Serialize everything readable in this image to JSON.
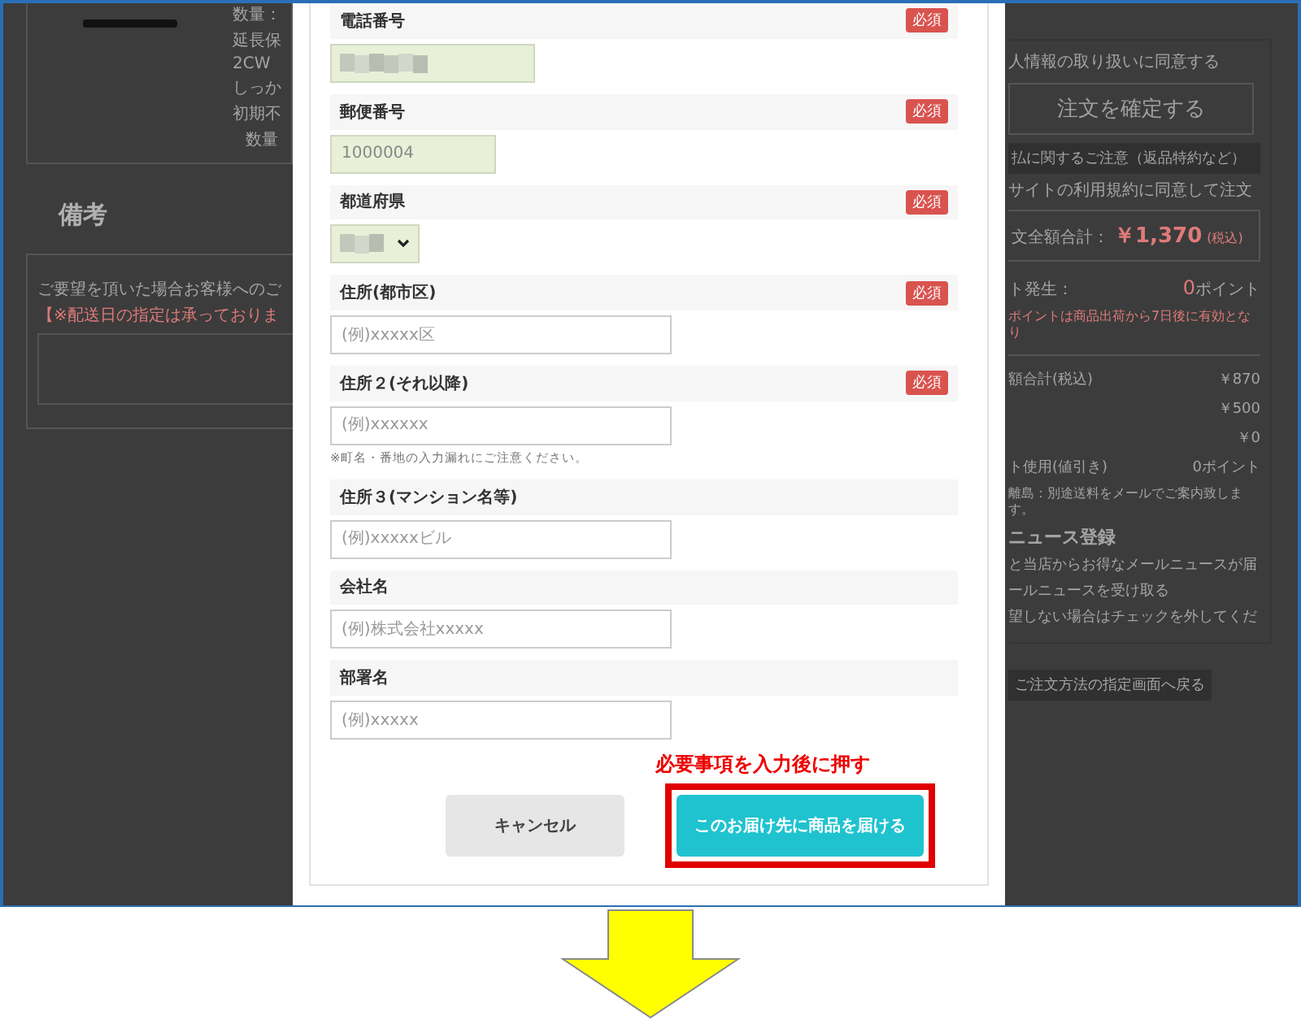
{
  "background": {
    "left": {
      "product": {
        "lines": [
          "数量：",
          "延長保",
          "2CW",
          "しっか",
          "初期不"
        ],
        "quantity": "数量"
      },
      "remarks": {
        "heading": "備考",
        "note": "ご要望を頂いた場合お客様へのご",
        "warning": "【※配送日の指定は承っておりま"
      }
    },
    "right": {
      "agree": "人情報の取り扱いに同意する",
      "confirm_button": "注文を確定する",
      "notice_bar": "払に関するご注意（返品特約など）",
      "terms": "サイトの利用規約に同意して注文",
      "total": {
        "label": "文全額合計：",
        "amount": "￥1,370",
        "tax": "(税込)"
      },
      "points": {
        "label": "ト発生：",
        "value": "0",
        "unit": "ポイント"
      },
      "points_note": "ポイントは商品出荷から7日後に有効となり",
      "summary": [
        {
          "label": "額合計(税込)",
          "value": "￥870"
        },
        {
          "value": "￥500"
        },
        {
          "value": "￥0"
        },
        {
          "label": "ト使用(値引き)",
          "value": "0ポイント"
        }
      ],
      "shipping_note": "離島：別途送料をメールでご案内致します。",
      "newsletter": {
        "heading": "ニュース登録",
        "text": "と当店からお得なメールニュースが届",
        "option": "ールニュースを受け取る",
        "hint": "望しない場合はチェックを外してくだ"
      },
      "back_button": "ご注文方法の指定画面へ戻る"
    }
  },
  "modal": {
    "fields": [
      {
        "label": "電話番号",
        "required": true,
        "badge": "必須",
        "input": {
          "kind": "text",
          "redacted": true,
          "autofilled": true
        }
      },
      {
        "label": "郵便番号",
        "required": true,
        "badge": "必須",
        "input": {
          "kind": "text",
          "value": "1000004",
          "autofilled": true
        }
      },
      {
        "label": "都道府県",
        "required": true,
        "badge": "必須",
        "input": {
          "kind": "select",
          "redacted": true,
          "autofilled": true
        }
      },
      {
        "label": "住所(都市区)",
        "required": true,
        "badge": "必須",
        "input": {
          "kind": "text",
          "placeholder": "(例)xxxxx区"
        }
      },
      {
        "label": "住所２(それ以降)",
        "required": true,
        "badge": "必須",
        "input": {
          "kind": "text",
          "placeholder": "(例)xxxxxx"
        },
        "note": "※町名・番地の入力漏れにご注意ください。"
      },
      {
        "label": "住所３(マンション名等)",
        "required": false,
        "input": {
          "kind": "text",
          "placeholder": "(例)xxxxxビル"
        }
      },
      {
        "label": "会社名",
        "required": false,
        "input": {
          "kind": "text",
          "placeholder": "(例)株式会社xxxxx"
        }
      },
      {
        "label": "部署名",
        "required": false,
        "input": {
          "kind": "text",
          "placeholder": "(例)xxxxx"
        }
      }
    ],
    "annotation": "必要事項を入力後に押す",
    "buttons": [
      {
        "label": "キャンセル",
        "kind": "secondary",
        "highlighted": false
      },
      {
        "label": "このお届け先に商品を届ける",
        "kind": "primary",
        "highlighted": true
      }
    ]
  }
}
